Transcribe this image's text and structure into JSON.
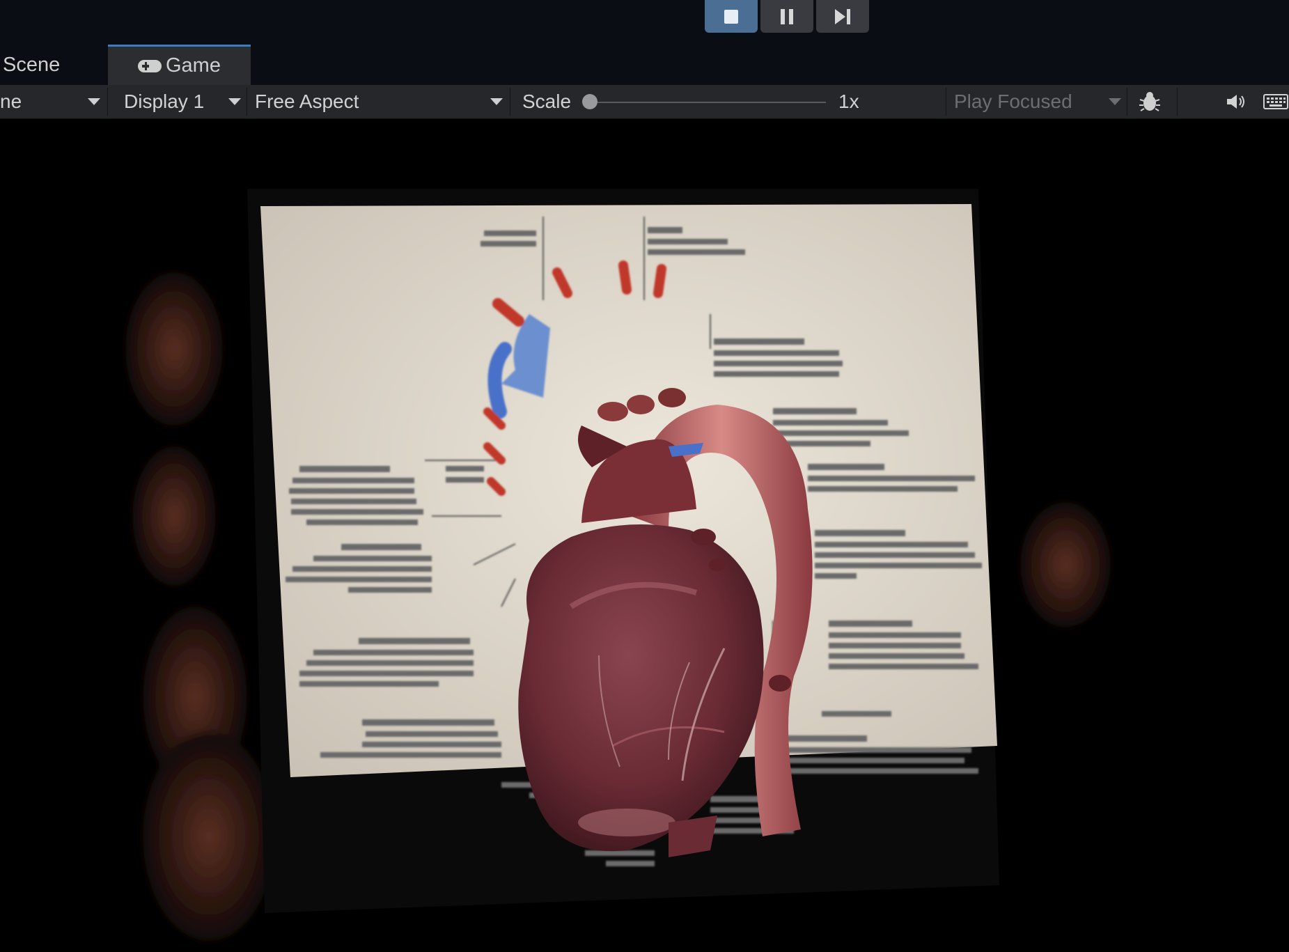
{
  "play_controls": {
    "stop_icon": "stop-icon",
    "pause_icon": "pause-icon",
    "step_icon": "step-icon",
    "active_color": "#4a6e94"
  },
  "tabs": {
    "scene_label": "Scene",
    "game_label": "Game",
    "game_icon": "gamepad-icon"
  },
  "toolbar": {
    "partial_dropdown_label": "ne",
    "display_label": "Display 1",
    "aspect_label": "Free Aspect",
    "scale_label": "Scale",
    "scale_value": "1x",
    "scale_slider_level": 0,
    "play_mode_label": "Play Focused",
    "bug_icon": "bug-icon",
    "audio_icon": "speaker-icon",
    "keyboard_icon": "keyboard-icon"
  },
  "viewport": {
    "description_icon": "ar-heart-model",
    "accent_color": "#3d7dc4"
  }
}
